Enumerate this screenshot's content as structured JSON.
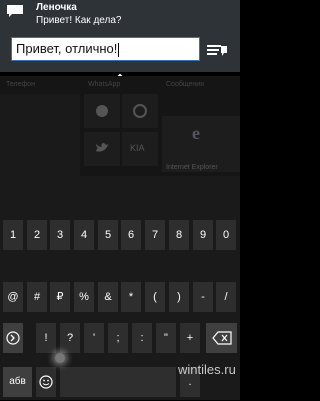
{
  "notification": {
    "sender": "Леночка",
    "message": "Привет! Как дела?",
    "reply_text": "Привет, отлично!"
  },
  "start_screen": {
    "labels": [
      "Телефон",
      "WhatsApp",
      "Сообщения",
      "KIA",
      "Internet Explorer"
    ]
  },
  "keyboard": {
    "row1": [
      "1",
      "2",
      "3",
      "4",
      "5",
      "6",
      "7",
      "8",
      "9",
      "0"
    ],
    "row2": [
      "@",
      "#",
      "₽",
      "%",
      "&",
      "*",
      "(",
      ")",
      "-",
      "/"
    ],
    "row3": [
      "!",
      "?",
      "'",
      ";",
      ":",
      "\"",
      "+",
      "=",
      ""
    ],
    "row4": {
      "lang": "абв",
      "space": "",
      "period": "."
    }
  },
  "watermark": "wintiles.ru",
  "colors": {
    "notification_bg": "#2e3338",
    "accent": "#3a6fb0",
    "key": "#2e2e2e",
    "key_dark": "#3f3f3f"
  }
}
